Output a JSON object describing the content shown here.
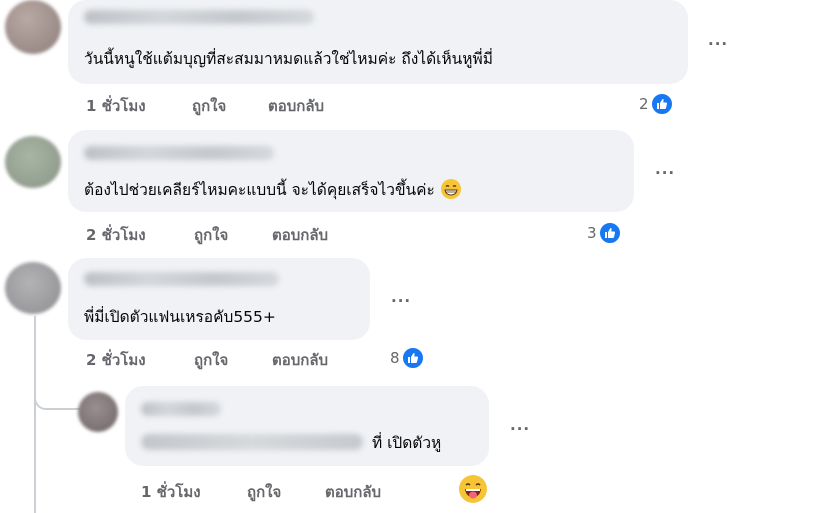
{
  "comments": [
    {
      "text": "วันนี้หนูใช้แต้มบุญที่สะสมมาหมดแล้วใช่ไหมค่ะ ถึงได้เห็นหูพี่มี่",
      "time": "1 ชั่วโมง",
      "like_label": "ถูกใจ",
      "reply_label": "ตอบกลับ",
      "reactions": "2",
      "more": "..."
    },
    {
      "text": "ต้องไปช่วยเคลียร์ไหมคะแบบนี้ จะได้คุยเสร็จไวขึ้นค่ะ",
      "time": "2 ชั่วโมง",
      "like_label": "ถูกใจ",
      "reply_label": "ตอบกลับ",
      "reactions": "3",
      "more": "..."
    },
    {
      "text": "พี่มี่เปิดตัวแฟนเหรอคับ555+",
      "time": "2 ชั่วโมง",
      "like_label": "ถูกใจ",
      "reply_label": "ตอบกลับ",
      "reactions": "8",
      "more": "..."
    }
  ],
  "reply": {
    "text": "ที่ เปิดตัวหู",
    "time": "1 ชั่วโมง",
    "like_label": "ถูกใจ",
    "reply_label": "ตอบกลับ",
    "more": "..."
  },
  "colors": {
    "like_blue": "#1877f2",
    "bubble": "#f0f2f5",
    "meta": "#65676b"
  },
  "icons": {
    "reaction": "like-icon",
    "emoji_grin": "grinning-emoji",
    "emoji_tongue": "tongue-out-emoji"
  }
}
